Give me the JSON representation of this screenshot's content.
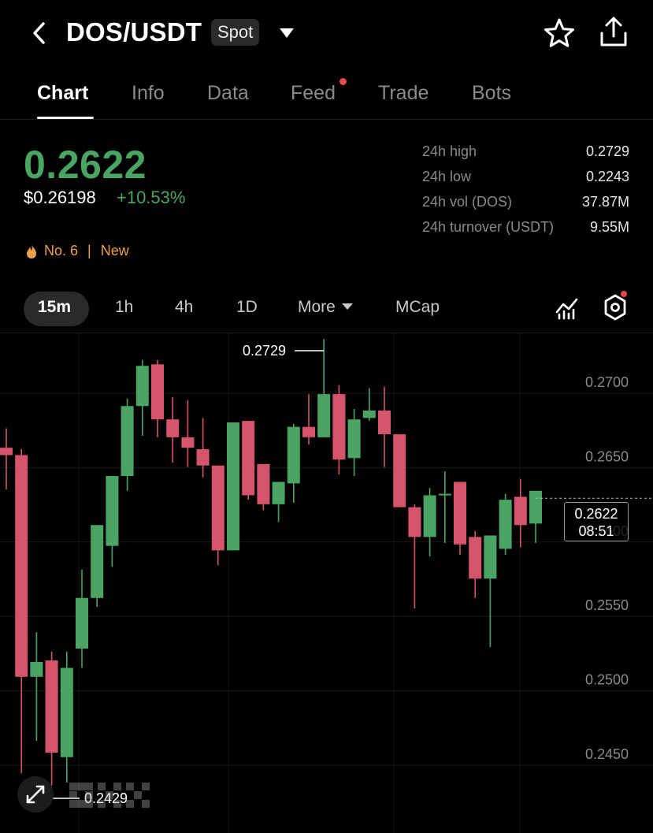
{
  "header": {
    "pair": "DOS/USDT",
    "market_type": "Spot"
  },
  "tabs": [
    {
      "label": "Chart",
      "active": true
    },
    {
      "label": "Info"
    },
    {
      "label": "Data"
    },
    {
      "label": "Feed",
      "has_notification": true
    },
    {
      "label": "Trade"
    },
    {
      "label": "Bots"
    }
  ],
  "ticker": {
    "last_price": "0.2622",
    "usd_price": "$0.26198",
    "change": "+10.53%",
    "stats": [
      {
        "label": "24h high",
        "value": "0.2729"
      },
      {
        "label": "24h low",
        "value": "0.2243"
      },
      {
        "label": "24h vol (DOS)",
        "value": "37.87M"
      },
      {
        "label": "24h turnover (USDT)",
        "value": "9.55M"
      }
    ],
    "rank": "No. 6",
    "tag": "New"
  },
  "intervals": {
    "items": [
      "15m",
      "1h",
      "4h",
      "1D",
      "More",
      "MCap"
    ],
    "selected": "15m"
  },
  "chart": {
    "y_axis_labels": [
      "0.2700",
      "0.2650",
      "0.2600",
      "0.2550",
      "0.2500",
      "0.2450"
    ],
    "high_marker": "0.2729",
    "low_marker": "0.2429",
    "last_price": "0.2622",
    "countdown": "08:51"
  },
  "colors": {
    "up": "#4aa564",
    "down": "#d4546b",
    "accent_orange": "#f0a04b",
    "notification": "#e5484d"
  },
  "chart_data": {
    "type": "candlestick",
    "interval": "15m",
    "y_range": [
      0.2425,
      0.2735
    ],
    "candles": [
      {
        "o": 0.2656,
        "h": 0.2669,
        "l": 0.2628,
        "c": 0.2651
      },
      {
        "o": 0.2651,
        "h": 0.2655,
        "l": 0.2437,
        "c": 0.2502
      },
      {
        "o": 0.2502,
        "h": 0.2532,
        "l": 0.2459,
        "c": 0.2512
      },
      {
        "o": 0.2513,
        "h": 0.2519,
        "l": 0.2429,
        "c": 0.2451
      },
      {
        "o": 0.2448,
        "h": 0.2519,
        "l": 0.2431,
        "c": 0.2508
      },
      {
        "o": 0.2521,
        "h": 0.2574,
        "l": 0.2508,
        "c": 0.2555
      },
      {
        "o": 0.2555,
        "h": 0.2592,
        "l": 0.2549,
        "c": 0.2604
      },
      {
        "o": 0.259,
        "h": 0.2637,
        "l": 0.2576,
        "c": 0.2637
      },
      {
        "o": 0.2637,
        "h": 0.2689,
        "l": 0.2627,
        "c": 0.2684
      },
      {
        "o": 0.2684,
        "h": 0.2715,
        "l": 0.2664,
        "c": 0.2711
      },
      {
        "o": 0.2712,
        "h": 0.2715,
        "l": 0.2663,
        "c": 0.2675
      },
      {
        "o": 0.2675,
        "h": 0.269,
        "l": 0.2646,
        "c": 0.2663
      },
      {
        "o": 0.2663,
        "h": 0.2688,
        "l": 0.2643,
        "c": 0.2656
      },
      {
        "o": 0.2655,
        "h": 0.2676,
        "l": 0.2636,
        "c": 0.2644
      },
      {
        "o": 0.2644,
        "h": 0.2644,
        "l": 0.2577,
        "c": 0.2587
      },
      {
        "o": 0.2587,
        "h": 0.2673,
        "l": 0.2587,
        "c": 0.2673
      },
      {
        "o": 0.2674,
        "h": 0.2674,
        "l": 0.2621,
        "c": 0.2624
      },
      {
        "o": 0.2645,
        "h": 0.2645,
        "l": 0.2614,
        "c": 0.2618
      },
      {
        "o": 0.2618,
        "h": 0.2633,
        "l": 0.2606,
        "c": 0.2633
      },
      {
        "o": 0.2632,
        "h": 0.2672,
        "l": 0.2619,
        "c": 0.267
      },
      {
        "o": 0.267,
        "h": 0.2692,
        "l": 0.2658,
        "c": 0.2663
      },
      {
        "o": 0.2663,
        "h": 0.2729,
        "l": 0.2663,
        "c": 0.2692
      },
      {
        "o": 0.2692,
        "h": 0.2698,
        "l": 0.2638,
        "c": 0.2648
      },
      {
        "o": 0.2649,
        "h": 0.2682,
        "l": 0.2637,
        "c": 0.2675
      },
      {
        "o": 0.2676,
        "h": 0.2696,
        "l": 0.2674,
        "c": 0.2681
      },
      {
        "o": 0.2681,
        "h": 0.2697,
        "l": 0.2643,
        "c": 0.2665
      },
      {
        "o": 0.2665,
        "h": 0.2664,
        "l": 0.2633,
        "c": 0.2616
      },
      {
        "o": 0.2616,
        "h": 0.2618,
        "l": 0.2548,
        "c": 0.2596
      },
      {
        "o": 0.2596,
        "h": 0.2629,
        "l": 0.2583,
        "c": 0.2624
      },
      {
        "o": 0.2624,
        "h": 0.264,
        "l": 0.2592,
        "c": 0.2625
      },
      {
        "o": 0.2633,
        "h": 0.2632,
        "l": 0.2584,
        "c": 0.2591
      },
      {
        "o": 0.2596,
        "h": 0.26,
        "l": 0.2555,
        "c": 0.2568
      },
      {
        "o": 0.2568,
        "h": 0.2595,
        "l": 0.2522,
        "c": 0.2597
      },
      {
        "o": 0.2588,
        "h": 0.2625,
        "l": 0.2584,
        "c": 0.2621
      },
      {
        "o": 0.2623,
        "h": 0.2635,
        "l": 0.2589,
        "c": 0.2604
      },
      {
        "o": 0.2605,
        "h": 0.2621,
        "l": 0.2592,
        "c": 0.2627
      }
    ]
  }
}
